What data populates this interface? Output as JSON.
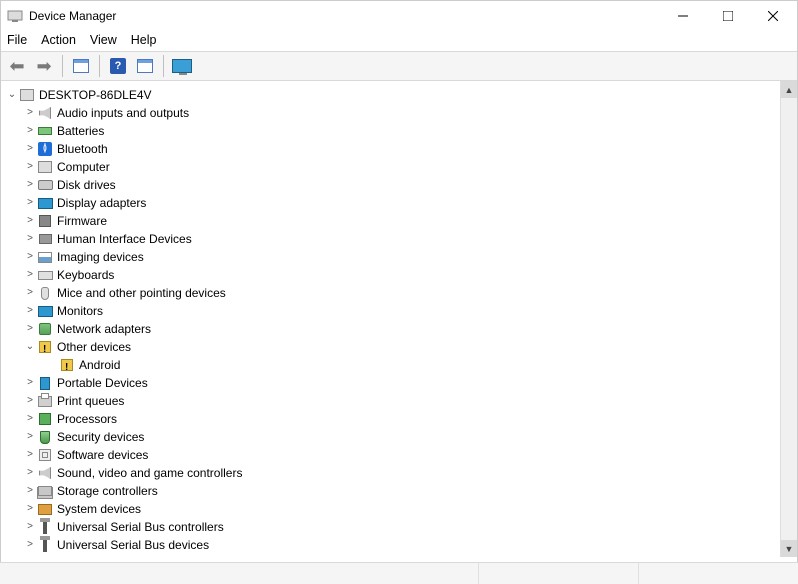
{
  "window": {
    "title": "Device Manager"
  },
  "menu": {
    "file": "File",
    "action": "Action",
    "view": "View",
    "help": "Help"
  },
  "tree": {
    "root": {
      "name": "DESKTOP-86DLE4V",
      "expanded": true
    },
    "categories": [
      {
        "name": "Audio inputs and outputs",
        "icon": "speaker",
        "expanded": false
      },
      {
        "name": "Batteries",
        "icon": "battery",
        "expanded": false
      },
      {
        "name": "Bluetooth",
        "icon": "bluetooth",
        "expanded": false
      },
      {
        "name": "Computer",
        "icon": "computer",
        "expanded": false
      },
      {
        "name": "Disk drives",
        "icon": "drive",
        "expanded": false
      },
      {
        "name": "Display adapters",
        "icon": "monitor",
        "expanded": false
      },
      {
        "name": "Firmware",
        "icon": "firmware",
        "expanded": false
      },
      {
        "name": "Human Interface Devices",
        "icon": "hid",
        "expanded": false
      },
      {
        "name": "Imaging devices",
        "icon": "imaging",
        "expanded": false
      },
      {
        "name": "Keyboards",
        "icon": "keyboard",
        "expanded": false
      },
      {
        "name": "Mice and other pointing devices",
        "icon": "mouse",
        "expanded": false
      },
      {
        "name": "Monitors",
        "icon": "monitor",
        "expanded": false
      },
      {
        "name": "Network adapters",
        "icon": "network",
        "expanded": false
      },
      {
        "name": "Other devices",
        "icon": "other",
        "expanded": true,
        "children": [
          {
            "name": "Android",
            "icon": "warning"
          }
        ]
      },
      {
        "name": "Portable Devices",
        "icon": "portable",
        "expanded": false
      },
      {
        "name": "Print queues",
        "icon": "printer",
        "expanded": false
      },
      {
        "name": "Processors",
        "icon": "cpu",
        "expanded": false
      },
      {
        "name": "Security devices",
        "icon": "security",
        "expanded": false
      },
      {
        "name": "Software devices",
        "icon": "software",
        "expanded": false
      },
      {
        "name": "Sound, video and game controllers",
        "icon": "speaker",
        "expanded": false
      },
      {
        "name": "Storage controllers",
        "icon": "storage",
        "expanded": false
      },
      {
        "name": "System devices",
        "icon": "system",
        "expanded": false
      },
      {
        "name": "Universal Serial Bus controllers",
        "icon": "usb",
        "expanded": false
      },
      {
        "name": "Universal Serial Bus devices",
        "icon": "usb",
        "expanded": false
      }
    ]
  }
}
